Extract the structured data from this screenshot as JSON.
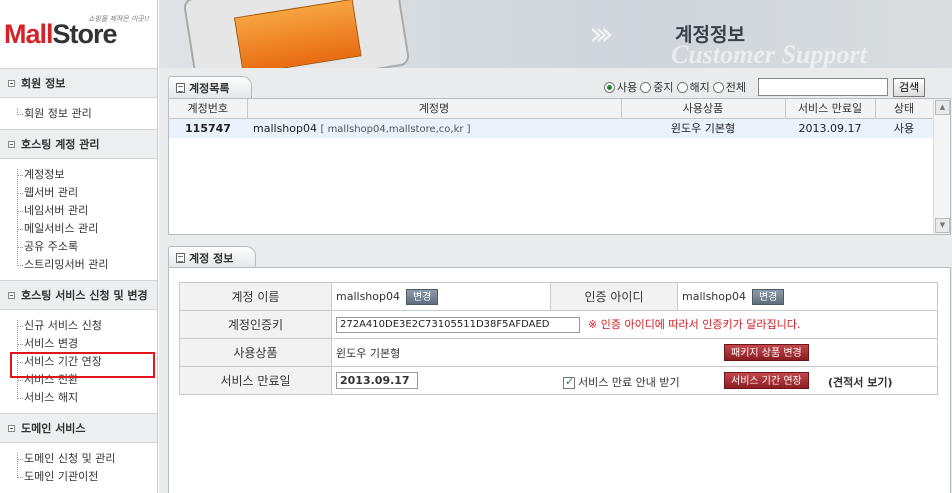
{
  "logo": {
    "part1": "Mall",
    "part2": "Store",
    "slogan": "쇼핑몰 제작은 이곳!!"
  },
  "banner": {
    "title": "계정정보",
    "subtitle": "Customer Support"
  },
  "sidebar": {
    "sections": [
      {
        "title": "회원 정보",
        "items": [
          "회원 정보 관리"
        ]
      },
      {
        "title": "호스팅 계정 관리",
        "items": [
          "계정정보",
          "웹서버 관리",
          "네임서버 관리",
          "메일서비스 관리",
          "공유 주소록",
          "스트리밍서버 관리"
        ]
      },
      {
        "title": "호스팅 서비스 신청 및 변경",
        "items": [
          "신규 서비스 신청",
          "서비스 변경",
          "서비스 기간 연장",
          "서비스 전환",
          "서비스 해지"
        ]
      },
      {
        "title": "도메인 서비스",
        "items": [
          "도메인 신청 및 관리",
          "도메인 기관이전"
        ]
      }
    ]
  },
  "account_list": {
    "tab_label": "계정목록",
    "filters": {
      "options": [
        "사용",
        "중지",
        "해지",
        "전체"
      ],
      "selected": "사용"
    },
    "search": {
      "value": "",
      "button": "검색"
    },
    "columns": [
      "계정번호",
      "계정명",
      "사용상품",
      "서비스 만료일",
      "상태"
    ],
    "rows": [
      {
        "number": "115747",
        "name": "mallshop04",
        "domains": "[ mallshop04,mallstore,co,kr ]",
        "product": "윈도우 기본형",
        "expiry": "2013.09.17",
        "status": "사용"
      }
    ]
  },
  "account_info": {
    "tab_label": "계정 정보",
    "name_label": "계정 이름",
    "name_value": "mallshop04",
    "change_btn": "변경",
    "auth_id_label": "인증 아이디",
    "auth_id_value": "mallshop04",
    "auth_id_change_btn": "변경",
    "auth_key_label": "계정인증키",
    "auth_key_value": "272A410DE3E2C73105511D38F5AFDAED",
    "auth_key_warning": "※ 인증 아이디에 따라서 인증키가 달라집니다.",
    "product_label": "사용상품",
    "product_value": "윈도우 기본형",
    "package_btn": "패키지 상품 변경",
    "expiry_label": "서비스 만료일",
    "expiry_value": "2013.09.17",
    "notice_checkbox_label": "서비스 만료 안내 받기",
    "notice_checked": true,
    "extend_btn": "서비스 기간 연장",
    "estimate_link": "(견적서 보기)"
  }
}
